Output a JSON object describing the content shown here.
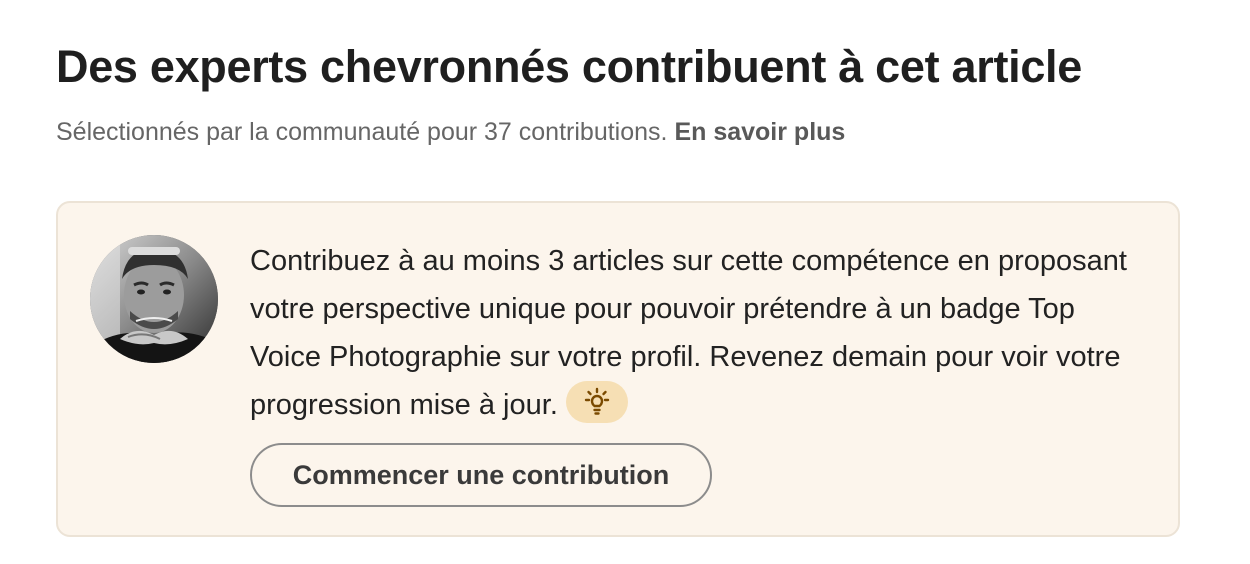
{
  "heading": {
    "title": "Des experts chevronnés contribuent à cet article",
    "subtitle": "Sélectionnés par la communauté pour 37 contributions.",
    "learn_more_label": "En savoir plus"
  },
  "card": {
    "avatar_icon": "user-avatar",
    "message": "Contribuez à au moins 3 articles sur cette compétence en proposant votre perspective unique pour pouvoir prétendre à un badge Top Voice Photographie sur votre profil. Revenez demain pour voir votre progression mise à jour.",
    "badge_icon": "lightbulb-icon",
    "cta_label": "Commencer une contribution"
  },
  "colors": {
    "card_background": "#fcf5ec",
    "card_border": "#ece3d6",
    "badge_background": "#f6dfb4",
    "badge_icon": "#7a4a00"
  }
}
